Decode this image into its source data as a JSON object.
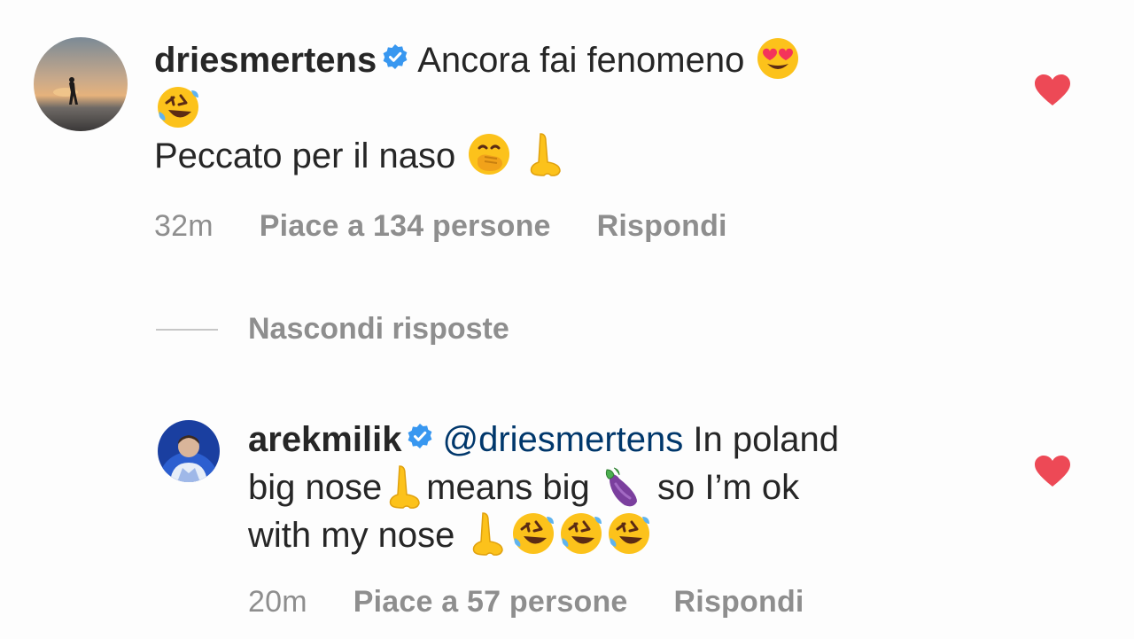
{
  "comments": [
    {
      "username": "driesmertens",
      "text_1": "Ancora fai fenomeno",
      "text_2": "Peccato per il naso",
      "time": "32m",
      "likes": "Piace a 134 persone",
      "reply": "Rispondi",
      "liked": true
    },
    {
      "username": "arekmilik",
      "mention": "@driesmertens",
      "text_1": "In poland",
      "text_2": "big nose",
      "text_3": "means big",
      "text_4": "so I’m ok",
      "text_5": "with my nose",
      "time": "20m",
      "likes": "Piace a 57 persone",
      "reply": "Rispondi",
      "liked": true
    }
  ],
  "hide_replies_label": "Nascondi risposte",
  "colors": {
    "heart": "#ed4956",
    "verified": "#3897f0",
    "meta": "#8e8e8e",
    "mention": "#00376b"
  },
  "icons": [
    "verified-badge-icon",
    "heart-icon",
    "heart-eyes-emoji",
    "rolling-laughing-emoji",
    "hand-over-mouth-emoji",
    "nose-emoji",
    "eggplant-emoji"
  ]
}
